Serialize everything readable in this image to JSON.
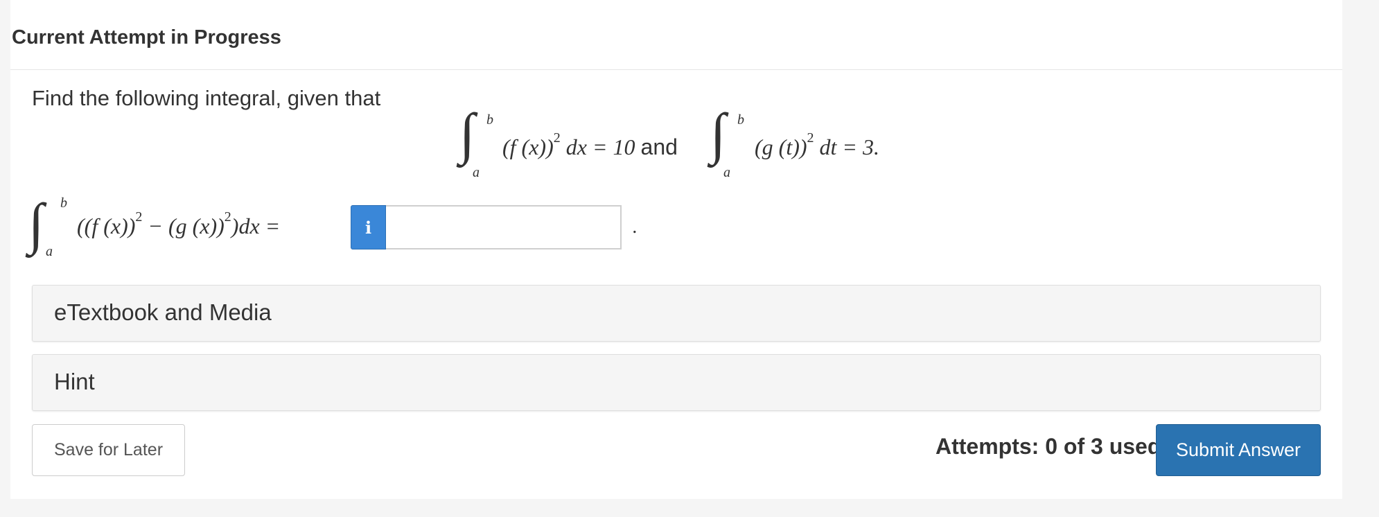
{
  "header": {
    "title": "Current Attempt in Progress"
  },
  "question": {
    "prompt": "Find the following integral, given that",
    "given1_integrand": "(f (x))",
    "given1_exp": "2",
    "given1_tail": "dx = 10",
    "connector": "and",
    "given2_integrand": "(g (t))",
    "given2_exp": "2",
    "given2_tail": "dt = 3.",
    "lower_limit": "a",
    "upper_limit": "b",
    "target_part1": "((f (x))",
    "target_part2": " − (g (x))",
    "target_part3": ")dx =",
    "target_exp": "2",
    "period": "."
  },
  "answer": {
    "info_label": "i",
    "value": "",
    "placeholder": ""
  },
  "panels": {
    "etextbook_label": "eTextbook and Media",
    "hint_label": "Hint"
  },
  "footer": {
    "save_label": "Save for Later",
    "attempts_text": "Attempts: 0 of 3 used",
    "submit_label": "Submit Answer"
  }
}
